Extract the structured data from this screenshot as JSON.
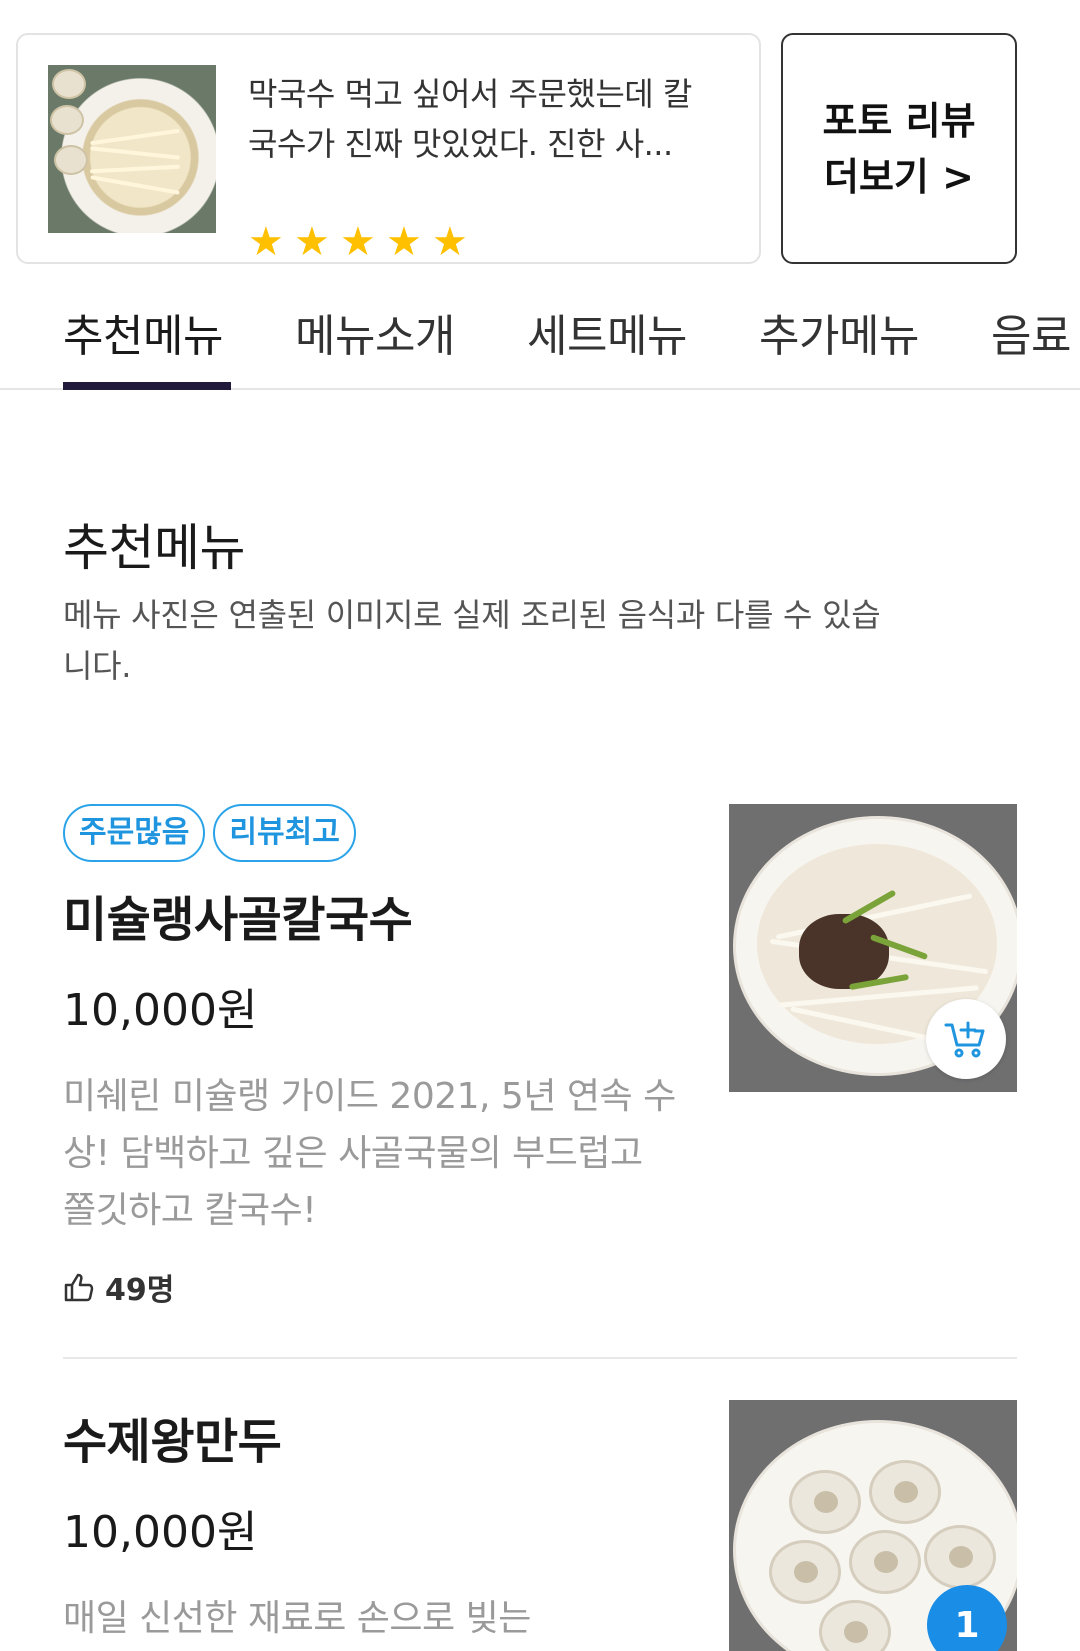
{
  "review": {
    "text": "막국수 먹고 싶어서 주문했는데 칼국수가 진짜 맛있었다. 진한 사...",
    "rating": 5,
    "star_glyph": "★",
    "star_color": "#ffc000"
  },
  "photo_review_button": {
    "line1": "포토 리뷰",
    "line2": "더보기 >"
  },
  "tabs": [
    {
      "label": "추천메뉴",
      "active": true
    },
    {
      "label": "메뉴소개",
      "active": false
    },
    {
      "label": "세트메뉴",
      "active": false
    },
    {
      "label": "추가메뉴",
      "active": false
    },
    {
      "label": "음료",
      "active": false
    }
  ],
  "section": {
    "title": "추천메뉴",
    "note": "메뉴 사진은 연출된 이미지로 실제 조리된 음식과 다를 수 있습니다."
  },
  "menu_items": [
    {
      "badges": [
        "주문많음",
        "리뷰최고"
      ],
      "name": "미슐랭사골칼국수",
      "price": "10,000원",
      "description": "미쉐린 미슐랭 가이드 2021, 5년 연속 수상! 담백하고 깊은 사골국물의 부드럽고 쫄깃하고 칼국수!",
      "likes": "49명",
      "photo_icon": "cart-plus-icon"
    },
    {
      "badges": [],
      "name": "수제왕만두",
      "price": "10,000원",
      "description": "매일 신선한 재료로 손으로 빚는",
      "cart_count": "1"
    }
  ],
  "colors": {
    "badge_blue": "#2aa3e8",
    "tab_indicator": "#221a3a",
    "count_badge": "#1a8de6"
  }
}
